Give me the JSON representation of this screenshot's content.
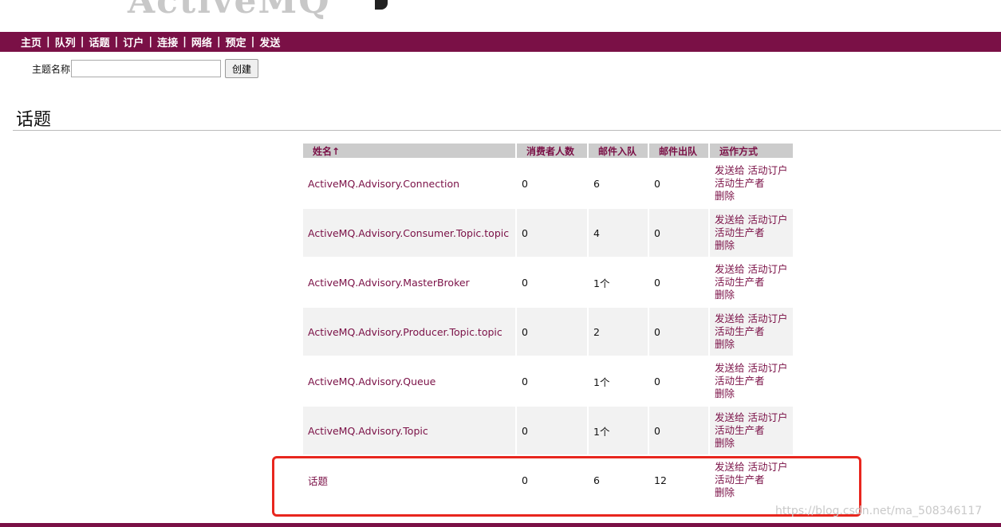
{
  "header": {
    "logo_text": "ActiveMQ"
  },
  "nav": {
    "items": [
      "主页",
      "队列",
      "话题",
      "订户",
      "连接",
      "网络",
      "预定",
      "发送"
    ],
    "separator": "|"
  },
  "create_form": {
    "label": "主题名称",
    "input_value": "",
    "button_label": "创建"
  },
  "section": {
    "title": "话题"
  },
  "table": {
    "headers": [
      "姓名↑",
      "消费者人数",
      "邮件入队",
      "邮件出队",
      "运作方式"
    ],
    "rows": [
      {
        "name": "ActiveMQ.Advisory.Connection",
        "consumers": "0",
        "enqueued": "6",
        "dequeued": "0"
      },
      {
        "name": "ActiveMQ.Advisory.Consumer.Topic.topic",
        "consumers": "0",
        "enqueued": "4",
        "dequeued": "0"
      },
      {
        "name": "ActiveMQ.Advisory.MasterBroker",
        "consumers": "0",
        "enqueued": "1个",
        "dequeued": "0"
      },
      {
        "name": "ActiveMQ.Advisory.Producer.Topic.topic",
        "consumers": "0",
        "enqueued": "2",
        "dequeued": "0"
      },
      {
        "name": "ActiveMQ.Advisory.Queue",
        "consumers": "0",
        "enqueued": "1个",
        "dequeued": "0"
      },
      {
        "name": "ActiveMQ.Advisory.Topic",
        "consumers": "0",
        "enqueued": "1个",
        "dequeued": "0"
      },
      {
        "name": "话题",
        "consumers": "0",
        "enqueued": "6",
        "dequeued": "12"
      }
    ],
    "operations": {
      "send": "发送给",
      "active_subscribers": "活动订户",
      "active_producers": "活动生产者",
      "delete": "删除"
    }
  },
  "watermark": "https://blog.csdn.net/ma_508346117",
  "colors": {
    "brand": "#7a1046",
    "header_bg": "#cccccc",
    "row_alt": "#f2f2f2",
    "highlight": "#e8261e"
  }
}
